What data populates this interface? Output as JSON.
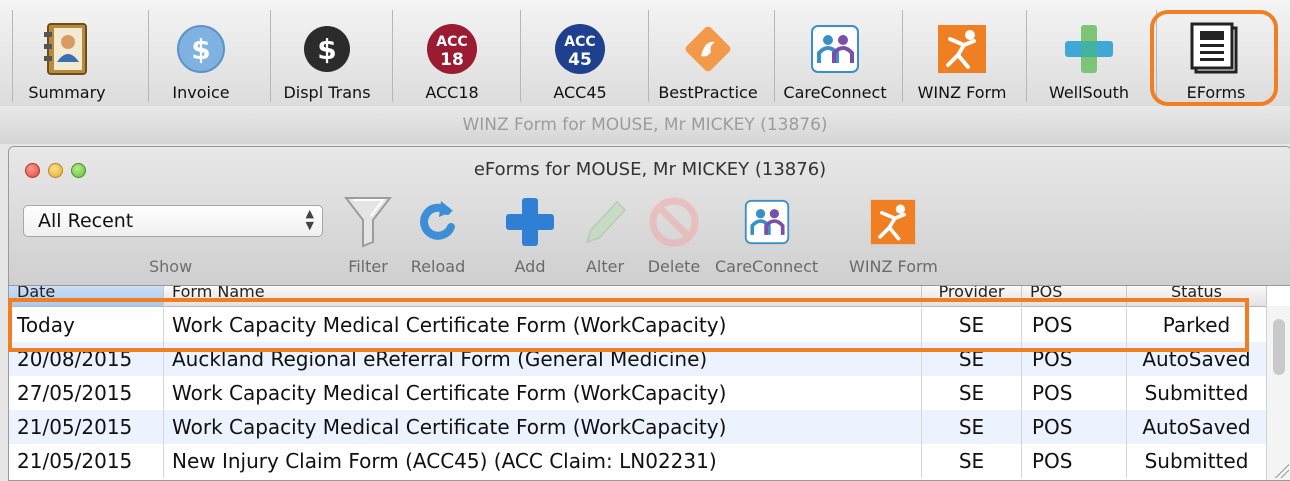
{
  "toolbar": {
    "buttons": [
      {
        "label": "Summary",
        "icon": "address-book-icon"
      },
      {
        "label": "Invoice",
        "icon": "dollar-coin-blue-icon"
      },
      {
        "label": "Displ Trans",
        "icon": "dollar-coin-black-icon"
      },
      {
        "label": "ACC18",
        "icon": "acc18-badge-icon",
        "badge_top": "ACC",
        "badge_bottom": "18"
      },
      {
        "label": "ACC45",
        "icon": "acc45-badge-icon",
        "badge_top": "ACC",
        "badge_bottom": "45"
      },
      {
        "label": "BestPractice",
        "icon": "bestpractice-logo-icon"
      },
      {
        "label": "CareConnect",
        "icon": "careconnect-people-icon"
      },
      {
        "label": "WINZ Form",
        "icon": "winz-figure-icon"
      },
      {
        "label": "WellSouth",
        "icon": "wellsouth-cross-icon"
      },
      {
        "label": "EForms",
        "icon": "eforms-document-icon"
      }
    ]
  },
  "background_window": {
    "title": "WINZ Form for MOUSE, Mr MICKEY (13876)"
  },
  "eforms_window": {
    "title": "eForms for MOUSE, Mr MICKEY (13876)",
    "show": {
      "selected": "All Recent",
      "label": "Show"
    },
    "tools": [
      {
        "label": "Filter",
        "icon": "filter-funnel-icon",
        "enabled": true
      },
      {
        "label": "Reload",
        "icon": "reload-arrow-icon",
        "enabled": true
      },
      {
        "label": "Add",
        "icon": "add-plus-icon",
        "enabled": true
      },
      {
        "label": "Alter",
        "icon": "alter-pencil-icon",
        "enabled": false
      },
      {
        "label": "Delete",
        "icon": "delete-prohibit-icon",
        "enabled": false
      },
      {
        "label": "CareConnect",
        "icon": "careconnect-people-icon",
        "enabled": true
      },
      {
        "label": "WINZ Form",
        "icon": "winz-figure-icon",
        "enabled": true
      }
    ],
    "table": {
      "columns": [
        "Date",
        "Form Name",
        "Provider",
        "POS",
        "Status"
      ],
      "rows": [
        {
          "date": "Today",
          "form": "Work Capacity Medical Certificate Form (WorkCapacity)",
          "provider": "SE",
          "pos": "POS",
          "status": "Parked"
        },
        {
          "date": "20/08/2015",
          "form": "Auckland Regional eReferral Form (General Medicine)",
          "provider": "SE",
          "pos": "POS",
          "status": "AutoSaved"
        },
        {
          "date": "27/05/2015",
          "form": "Work Capacity Medical Certificate Form (WorkCapacity)",
          "provider": "SE",
          "pos": "POS",
          "status": "Submitted"
        },
        {
          "date": "21/05/2015",
          "form": "Work Capacity Medical Certificate Form (WorkCapacity)",
          "provider": "SE",
          "pos": "POS",
          "status": "AutoSaved"
        },
        {
          "date": "21/05/2015",
          "form": "New Injury Claim Form (ACC45) (ACC Claim: LN02231)",
          "provider": "SE",
          "pos": "POS",
          "status": "Submitted"
        }
      ]
    }
  },
  "colors": {
    "highlight": "#f07f23",
    "alt_row": "#edf3fe"
  }
}
